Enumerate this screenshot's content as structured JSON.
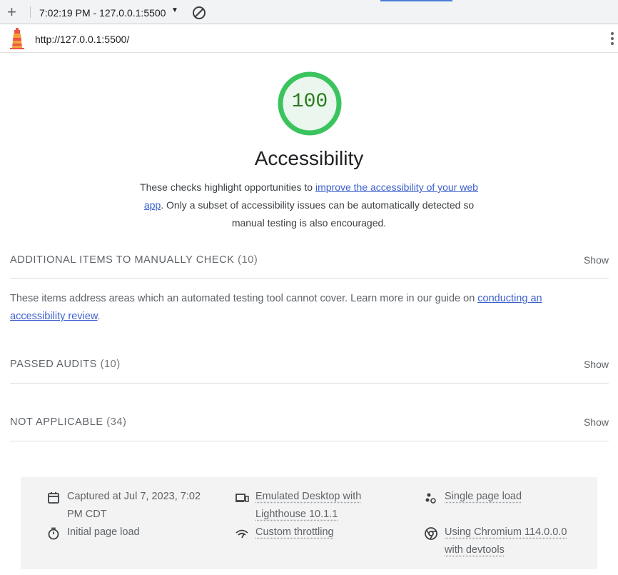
{
  "toolbar": {
    "new_icon": "plus-icon",
    "report_label": "7:02:19 PM - 127.0.0.1:5500",
    "dropdown_icon": "caret-down-icon",
    "clear_icon": "block-icon"
  },
  "urlbar": {
    "logo": "lighthouse-logo",
    "url": "http://127.0.0.1:5500/",
    "menu_icon": "kebab-menu-icon"
  },
  "score": {
    "value": "100",
    "color": "#0cce6b",
    "text_color": "#2a7b1b",
    "fill": "#eaf6ee"
  },
  "category": {
    "title": "Accessibility",
    "desc_before": "These checks highlight opportunities to ",
    "desc_link": "improve the accessibility of your web app",
    "desc_after": ". Only a subset of accessibility issues can be automatically detected so manual testing is also encouraged."
  },
  "groups": {
    "manual": {
      "title": "ADDITIONAL ITEMS TO MANUALLY CHECK",
      "count": "(10)",
      "show": "Show",
      "desc_before": "These items address areas which an automated testing tool cannot cover. Learn more in our guide on ",
      "desc_link": "conducting an accessibility review",
      "desc_after": "."
    },
    "passed": {
      "title": "PASSED AUDITS",
      "count": "(10)",
      "show": "Show"
    },
    "na": {
      "title": "NOT APPLICABLE",
      "count": "(34)",
      "show": "Show"
    }
  },
  "footer": {
    "captured": "Captured at Jul 7, 2023, 7:02 PM CDT",
    "initial_load": "Initial page load",
    "emulated": "Emulated Desktop with Lighthouse 10.1.1",
    "throttling": "Custom throttling",
    "single_load": "Single page load",
    "chromium": "Using Chromium 114.0.0.0 with devtools"
  },
  "colors": {
    "link": "#3b5fcc",
    "toolbar_bg": "#f1f3f4",
    "footer_bg": "#f3f3f3",
    "tab_indicator": "#4a7ed7"
  }
}
